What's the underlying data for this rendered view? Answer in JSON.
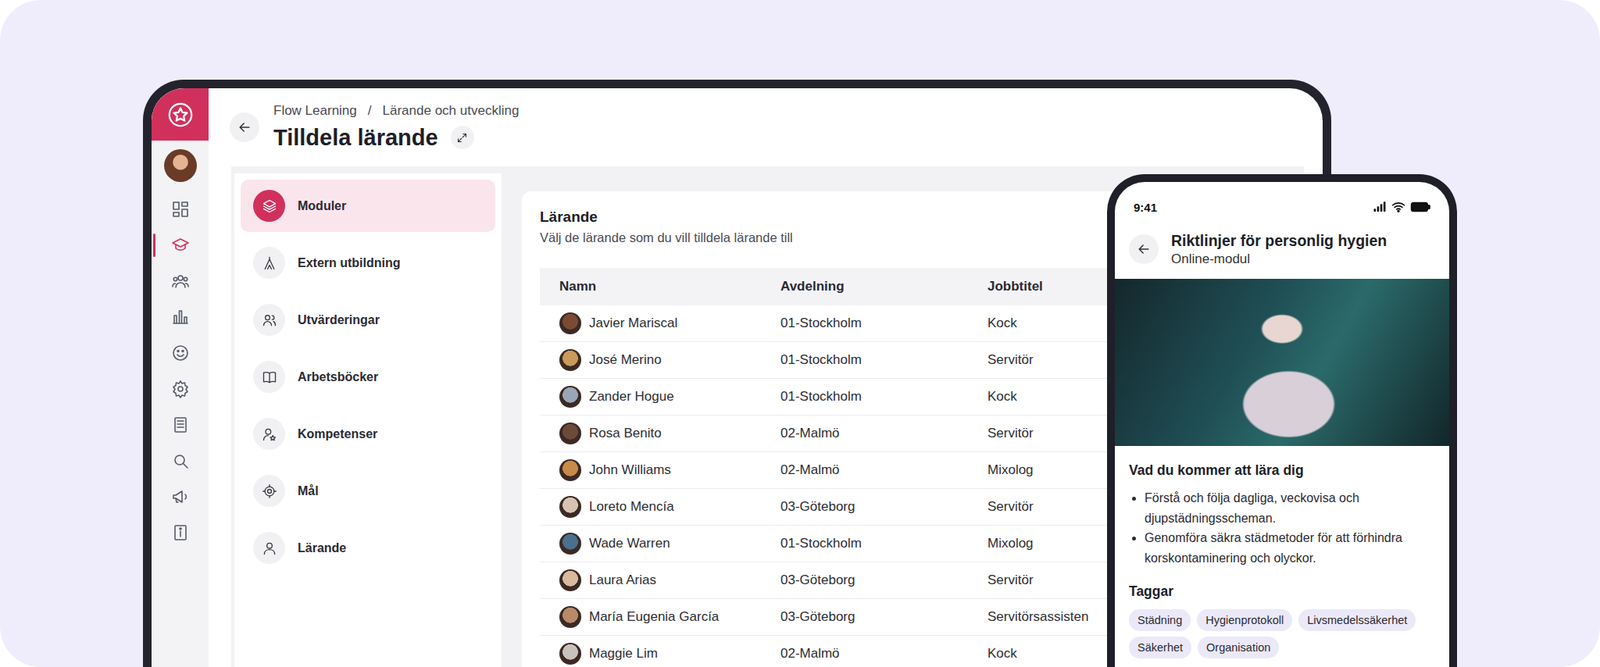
{
  "header": {
    "breadcrumb": [
      "Flow Learning",
      "/",
      "Lärande och utveckling"
    ],
    "title": "Tilldela lärande"
  },
  "sidebar": {
    "items": [
      {
        "selected": false
      },
      {
        "selected": true
      },
      {
        "selected": false
      },
      {
        "selected": false
      },
      {
        "selected": false
      },
      {
        "selected": false
      },
      {
        "selected": false
      },
      {
        "selected": false
      },
      {
        "selected": false
      },
      {
        "selected": false
      }
    ]
  },
  "menu": {
    "items": [
      {
        "label": "Moduler",
        "selected": true
      },
      {
        "label": "Extern utbildning",
        "selected": false
      },
      {
        "label": "Utvärderingar",
        "selected": false
      },
      {
        "label": "Arbetsböcker",
        "selected": false
      },
      {
        "label": "Kompetenser",
        "selected": false
      },
      {
        "label": "Mål",
        "selected": false
      },
      {
        "label": "Lärande",
        "selected": false
      }
    ]
  },
  "card": {
    "title": "Lärande",
    "subtitle": "Välj de lärande som du vill tilldela lärande till"
  },
  "table": {
    "columns": [
      "Namn",
      "Avdelning",
      "Jobbtitel"
    ],
    "rows": [
      [
        "Javier Mariscal",
        "01-Stockholm",
        "Kock"
      ],
      [
        "José Merino",
        "01-Stockholm",
        "Servitör"
      ],
      [
        "Zander Hogue",
        "01-Stockholm",
        "Kock"
      ],
      [
        "Rosa Benito",
        "02-Malmö",
        "Servitör"
      ],
      [
        "John Williams",
        "02-Malmö",
        "Mixolog"
      ],
      [
        "Loreto Mencía",
        "03-Göteborg",
        "Servitör"
      ],
      [
        "Wade Warren",
        "01-Stockholm",
        "Mixolog"
      ],
      [
        "Laura Arias",
        "03-Göteborg",
        "Servitör"
      ],
      [
        "María Eugenia García",
        "03-Göteborg",
        "Servitörsassisten"
      ],
      [
        "Maggie Lim",
        "02-Malmö",
        "Kock"
      ]
    ]
  },
  "phone": {
    "time": "9:41",
    "title": "Riktlinjer för personlig hygien",
    "subtitle": "Online-modul",
    "section_title": "Vad du kommer att lära dig",
    "bullets": [
      "Förstå och följa dagliga, veckovisa och djupstädningsscheman.",
      "Genomföra säkra städmetoder för att förhindra korskontaminering och olyckor."
    ],
    "tags_title": "Taggar",
    "tags": [
      "Städning",
      "Hygienprotokoll",
      "Livsmedelssäkerhet",
      "Säkerhet",
      "Organisation"
    ]
  }
}
